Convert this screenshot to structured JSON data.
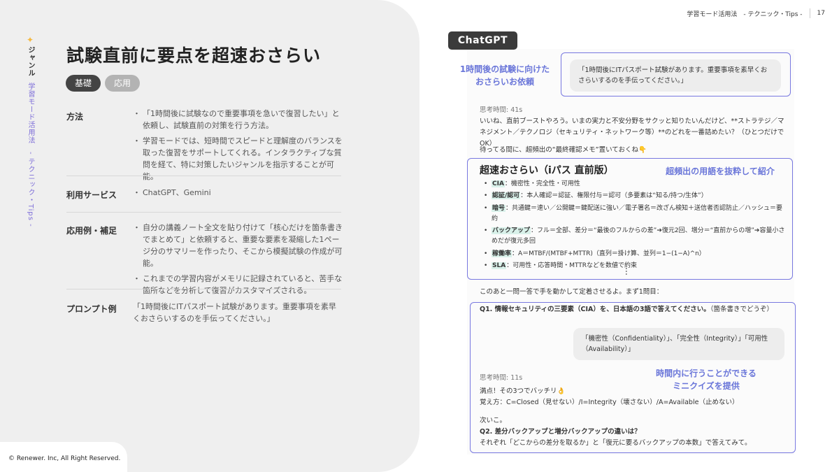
{
  "header": {
    "text": "学習モード活用法　- テクニック・Tips -",
    "page": "17"
  },
  "left": {
    "star": "✦",
    "genre_label": "ジャンル",
    "category_label": "学習モード活用法　- テクニック・Tips -",
    "title": "試験直前に要点を超速おさらい",
    "tags": [
      "基礎",
      "応用"
    ],
    "rows": [
      {
        "label": "方法",
        "bullets": [
          "「1時間後に試験なので重要事項を急いで復習したい」と依頼し、試験直前の対策を行う方法。",
          "学習モードでは、短時間でスピードと理解度のバランスを取った復習をサポートしてくれる。インタラクティブな質問を経て、特に対策したいジャンルを指示することが可能。"
        ]
      },
      {
        "label": "利用サービス",
        "bullets": [
          "ChatGPT、Gemini"
        ]
      },
      {
        "label": "応用例・補足",
        "bullets": [
          "自分の講義ノート全文を貼り付けて「核心だけを箇条書きでまとめて」と依頼すると、重要な要素を凝縮した1ページ分のサマリーを作ったり、そこから模擬試験の作成が可能。",
          "これまでの学習内容がメモリに記録されていると、苦手な箇所などを分析して復習がカスタマイズされる。"
        ]
      },
      {
        "label": "プロンプト例",
        "text": "「1時間後にITパスポート試験があります。重要事項を素早くおさらいするのを手伝ってください。」"
      }
    ],
    "copyright": "© Renewer. Inc, All Right Reserved."
  },
  "chat": {
    "tag": "ChatGPT",
    "annot_request": "1時間後の試験に向けた\nおさらいお依頼",
    "user_prompt": "「1時間後にITパスポート試験があります。重要事項を素早くおさらいするのを手伝ってください。」",
    "think1": "思考時間: 41s",
    "reply1": "いいね、直前ブーストやろう。いまの実力と不安分野をサクッと知りたいんだけど、**ストラテジ／マネジメント／テクノロジ（セキュリティ・ネットワーク等）**のどれを一番詰めたい？（ひとつだけでOK）",
    "reply2": "待ってる間に、超頻出の“最終確認メモ”置いておくね👇",
    "summary_title": "超速おさらい（iパス 直前版）",
    "annot_terms": "超頻出の用語を抜粋して紹介",
    "summary_items": [
      {
        "key": "CIA",
        "text": "：機密性・完全性・可用性"
      },
      {
        "key": "認証/認可",
        "text": "：本人確認＝認証、権限付与＝認可（多要素は“知る/持つ/生体”）"
      },
      {
        "key": "暗号",
        "text": "：共通鍵＝速い／公開鍵＝鍵配送に強い／電子署名＝改ざん検知＋送信者否認防止／ハッシュ＝要約"
      },
      {
        "key": "バックアップ",
        "text": "：フル＝全部、差分＝“最後のフルからの差”➔復元2回、増分＝“直前からの増”➔容量小さめだが復元多回"
      },
      {
        "key": "稼働率",
        "text": "：A＝MTBF/(MTBF+MTTR)（直列＝掛け算、並列＝1−(1−A)^n）"
      },
      {
        "key": "SLA",
        "text": "：可用性・応答時間・MTTRなどを数値で約束"
      }
    ],
    "ellipsis": "…",
    "next_text": "このあと一問一答で手を動かして定着させるよ。まず1問目：",
    "q1": "Q1. 情報セキュリティの三要素（CIA）を、日本語の3語で答えてください。",
    "q1_note": "（箇条書きでどうぞ）",
    "user_answer": "「機密性（Confidentiality）」、「完全性（Integrity）」「可用性（Availability）」",
    "think2": "思考時間: 11s",
    "annot_quiz": "時間内に行うことができる\nミニクイズを提供",
    "perfect": "満点！その3つでバッチリ👌",
    "mnemonic": "覚え方：C=Closed（見せない）/I=Integrity（壊さない）/A=Available（止めない）",
    "next": "次いこ。",
    "q2": "Q2. 差分バックアップと増分バックアップの違いは？",
    "q2_sub": "それぞれ「どこからの差分を取るか」と「復元に要るバックアップの本数」で答えてみて。"
  }
}
